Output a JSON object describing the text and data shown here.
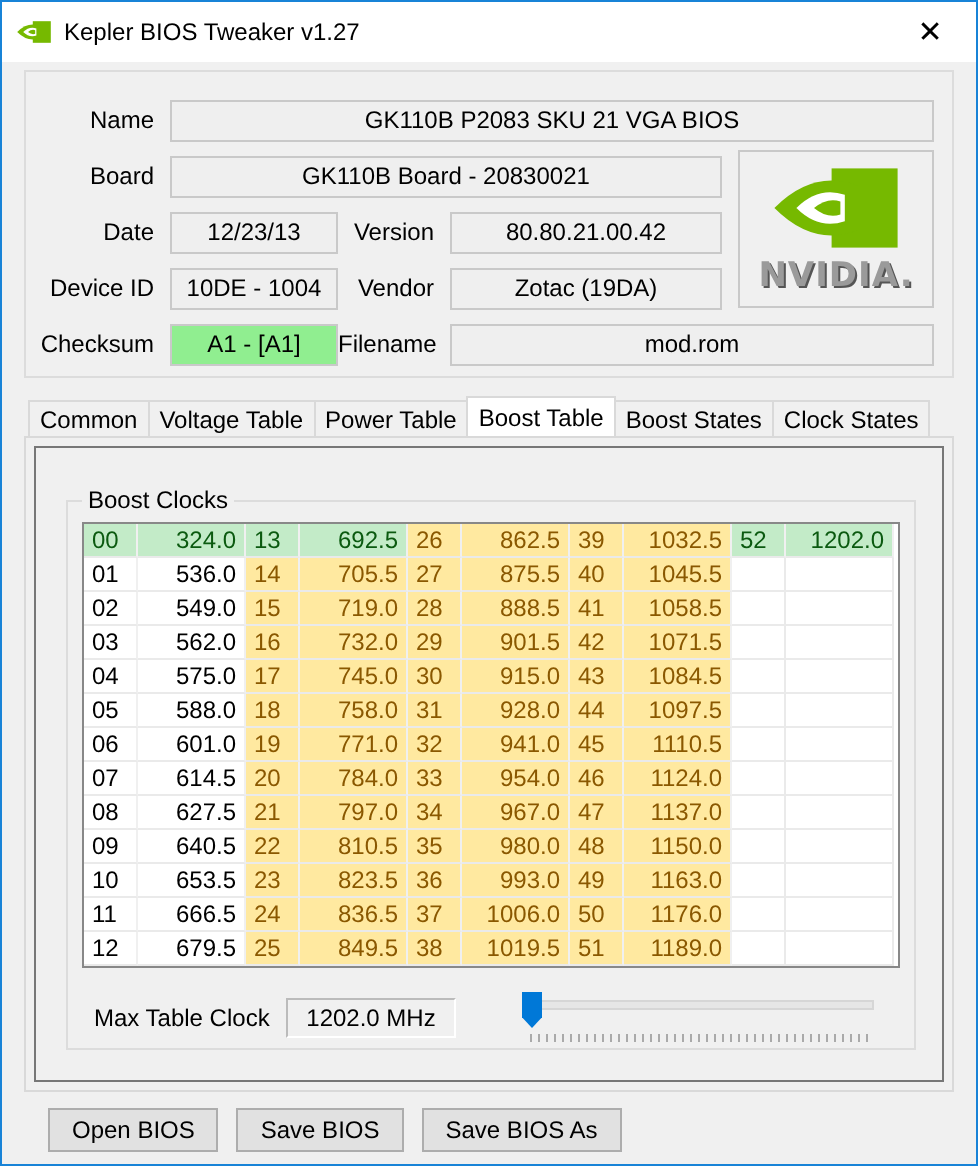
{
  "window": {
    "title": "Kepler BIOS Tweaker v1.27",
    "close": "✕"
  },
  "info": {
    "name": {
      "label": "Name",
      "value": "GK110B P2083 SKU 21 VGA BIOS"
    },
    "board": {
      "label": "Board",
      "value": "GK110B Board - 20830021"
    },
    "date": {
      "label": "Date",
      "value": "12/23/13"
    },
    "version": {
      "label": "Version",
      "value": "80.80.21.00.42"
    },
    "device_id": {
      "label": "Device ID",
      "value": "10DE - 1004"
    },
    "vendor": {
      "label": "Vendor",
      "value": "Zotac (19DA)"
    },
    "checksum": {
      "label": "Checksum",
      "value": "A1 - [A1]",
      "valid": true
    },
    "filename": {
      "label": "Filename",
      "value": "mod.rom"
    },
    "logo_text": "NVIDIA."
  },
  "tabs": [
    {
      "label": "Common",
      "selected": false
    },
    {
      "label": "Voltage Table",
      "selected": false
    },
    {
      "label": "Power Table",
      "selected": false
    },
    {
      "label": "Boost Table",
      "selected": true
    },
    {
      "label": "Boost States",
      "selected": false
    },
    {
      "label": "Clock States",
      "selected": false
    }
  ],
  "boost_clocks": {
    "title": "Boost Clocks",
    "rows": [
      [
        {
          "index": "00",
          "clock": "324.0",
          "kind": "current"
        },
        {
          "index": "13",
          "clock": "692.5",
          "kind": "current"
        },
        {
          "index": "26",
          "clock": "862.5",
          "kind": "boost"
        },
        {
          "index": "39",
          "clock": "1032.5",
          "kind": "boost"
        },
        {
          "index": "52",
          "clock": "1202.0",
          "kind": "current"
        }
      ],
      [
        {
          "index": "01",
          "clock": "536.0",
          "kind": "base"
        },
        {
          "index": "14",
          "clock": "705.5",
          "kind": "boost"
        },
        {
          "index": "27",
          "clock": "875.5",
          "kind": "boost"
        },
        {
          "index": "40",
          "clock": "1045.5",
          "kind": "boost"
        }
      ],
      [
        {
          "index": "02",
          "clock": "549.0",
          "kind": "base"
        },
        {
          "index": "15",
          "clock": "719.0",
          "kind": "boost"
        },
        {
          "index": "28",
          "clock": "888.5",
          "kind": "boost"
        },
        {
          "index": "41",
          "clock": "1058.5",
          "kind": "boost"
        }
      ],
      [
        {
          "index": "03",
          "clock": "562.0",
          "kind": "base"
        },
        {
          "index": "16",
          "clock": "732.0",
          "kind": "boost"
        },
        {
          "index": "29",
          "clock": "901.5",
          "kind": "boost"
        },
        {
          "index": "42",
          "clock": "1071.5",
          "kind": "boost"
        }
      ],
      [
        {
          "index": "04",
          "clock": "575.0",
          "kind": "base"
        },
        {
          "index": "17",
          "clock": "745.0",
          "kind": "boost"
        },
        {
          "index": "30",
          "clock": "915.0",
          "kind": "boost"
        },
        {
          "index": "43",
          "clock": "1084.5",
          "kind": "boost"
        }
      ],
      [
        {
          "index": "05",
          "clock": "588.0",
          "kind": "base"
        },
        {
          "index": "18",
          "clock": "758.0",
          "kind": "boost"
        },
        {
          "index": "31",
          "clock": "928.0",
          "kind": "boost"
        },
        {
          "index": "44",
          "clock": "1097.5",
          "kind": "boost"
        }
      ],
      [
        {
          "index": "06",
          "clock": "601.0",
          "kind": "base"
        },
        {
          "index": "19",
          "clock": "771.0",
          "kind": "boost"
        },
        {
          "index": "32",
          "clock": "941.0",
          "kind": "boost"
        },
        {
          "index": "45",
          "clock": "1110.5",
          "kind": "boost"
        }
      ],
      [
        {
          "index": "07",
          "clock": "614.5",
          "kind": "base"
        },
        {
          "index": "20",
          "clock": "784.0",
          "kind": "boost"
        },
        {
          "index": "33",
          "clock": "954.0",
          "kind": "boost"
        },
        {
          "index": "46",
          "clock": "1124.0",
          "kind": "boost"
        }
      ],
      [
        {
          "index": "08",
          "clock": "627.5",
          "kind": "base"
        },
        {
          "index": "21",
          "clock": "797.0",
          "kind": "boost"
        },
        {
          "index": "34",
          "clock": "967.0",
          "kind": "boost"
        },
        {
          "index": "47",
          "clock": "1137.0",
          "kind": "boost"
        }
      ],
      [
        {
          "index": "09",
          "clock": "640.5",
          "kind": "base"
        },
        {
          "index": "22",
          "clock": "810.5",
          "kind": "boost"
        },
        {
          "index": "35",
          "clock": "980.0",
          "kind": "boost"
        },
        {
          "index": "48",
          "clock": "1150.0",
          "kind": "boost"
        }
      ],
      [
        {
          "index": "10",
          "clock": "653.5",
          "kind": "base"
        },
        {
          "index": "23",
          "clock": "823.5",
          "kind": "boost"
        },
        {
          "index": "36",
          "clock": "993.0",
          "kind": "boost"
        },
        {
          "index": "49",
          "clock": "1163.0",
          "kind": "boost"
        }
      ],
      [
        {
          "index": "11",
          "clock": "666.5",
          "kind": "base"
        },
        {
          "index": "24",
          "clock": "836.5",
          "kind": "boost"
        },
        {
          "index": "37",
          "clock": "1006.0",
          "kind": "boost"
        },
        {
          "index": "50",
          "clock": "1176.0",
          "kind": "boost"
        }
      ],
      [
        {
          "index": "12",
          "clock": "679.5",
          "kind": "base"
        },
        {
          "index": "25",
          "clock": "849.5",
          "kind": "boost"
        },
        {
          "index": "38",
          "clock": "1019.5",
          "kind": "boost"
        },
        {
          "index": "51",
          "clock": "1189.0",
          "kind": "boost"
        }
      ]
    ],
    "max_clock": {
      "label": "Max Table Clock",
      "value": "1202.0 MHz"
    },
    "slider": {
      "level": 0
    }
  },
  "buttons": [
    "Open BIOS",
    "Save BIOS",
    "Save BIOS As"
  ]
}
